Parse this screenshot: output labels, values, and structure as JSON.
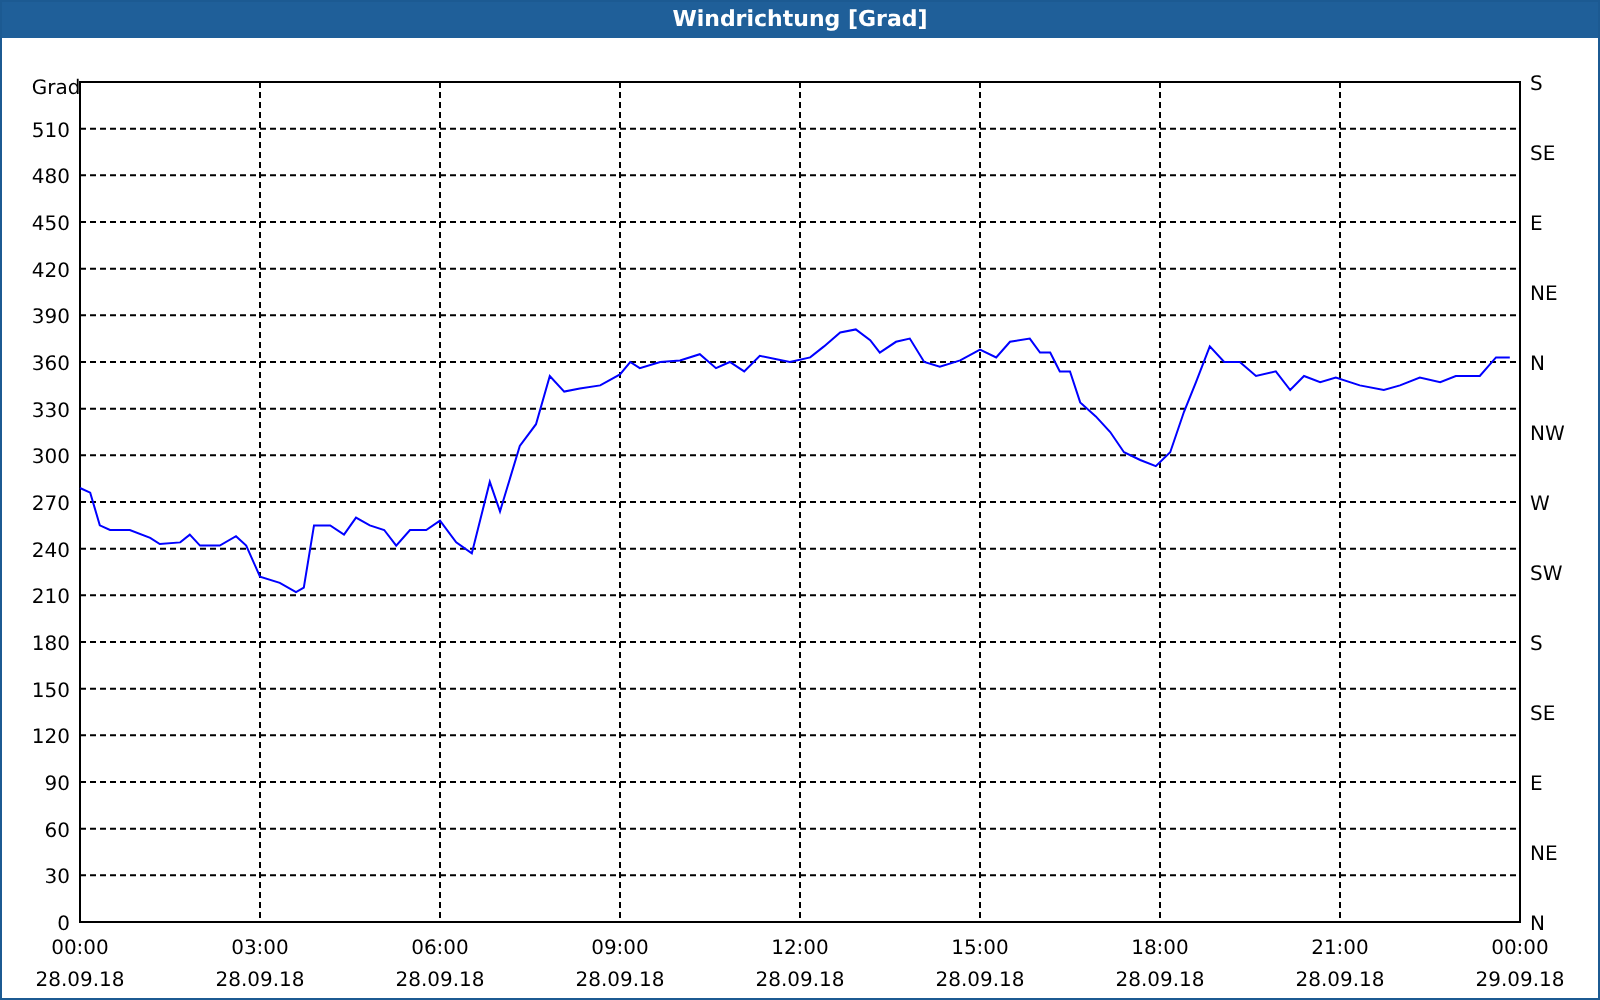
{
  "chart": {
    "chart_data": {
      "type": "line",
      "grid": true,
      "title": "Windrichtung [Grad]",
      "ylabel": "Grad",
      "ylim": [
        0,
        540
      ],
      "xlim": [
        0,
        24
      ],
      "yticks": [
        0,
        30,
        60,
        90,
        120,
        150,
        180,
        210,
        240,
        270,
        300,
        330,
        360,
        390,
        420,
        450,
        480,
        510
      ],
      "xticks": [
        {
          "value": 0,
          "label": "00:00"
        },
        {
          "value": 3,
          "label": "03:00"
        },
        {
          "value": 6,
          "label": "06:00"
        },
        {
          "value": 9,
          "label": "09:00"
        },
        {
          "value": 12,
          "label": "12:00"
        },
        {
          "value": 15,
          "label": "15:00"
        },
        {
          "value": 18,
          "label": "18:00"
        },
        {
          "value": 21,
          "label": "21:00"
        },
        {
          "value": 24,
          "label": "00:00"
        }
      ],
      "x": [
        0,
        0.17,
        0.33,
        0.5,
        0.83,
        1.17,
        1.33,
        1.67,
        1.83,
        2,
        2.33,
        2.6,
        2.77,
        3,
        3.33,
        3.6,
        3.73,
        3.9,
        4.17,
        4.4,
        4.6,
        4.83,
        5.07,
        5.27,
        5.5,
        5.77,
        6,
        6.27,
        6.53,
        6.83,
        7,
        7.33,
        7.6,
        7.83,
        8.07,
        8.33,
        8.67,
        9,
        9.17,
        9.33,
        9.67,
        10,
        10.33,
        10.6,
        10.83,
        11.07,
        11.33,
        11.83,
        12.17,
        12.4,
        12.67,
        12.93,
        13.17,
        13.33,
        13.6,
        13.83,
        14.07,
        14.33,
        14.67,
        15,
        15.27,
        15.5,
        15.83,
        16,
        16.17,
        16.33,
        16.5,
        16.67,
        16.93,
        17.17,
        17.4,
        17.67,
        17.93,
        18.17,
        18.4,
        18.6,
        18.83,
        19.07,
        19.33,
        19.6,
        19.93,
        20.17,
        20.4,
        20.67,
        20.93,
        21.33,
        21.73,
        22,
        22.33,
        22.67,
        22.93,
        23.33,
        23.6,
        23.83
      ],
      "series": [
        {
          "color": "#0000ff",
          "values": [
            279,
            276,
            255,
            252,
            252,
            247,
            243,
            244,
            249,
            242,
            242,
            248,
            242,
            222,
            218,
            212,
            215,
            255,
            255,
            249,
            260,
            255,
            252,
            242,
            252,
            252,
            258,
            244,
            237,
            283,
            264,
            306,
            320,
            351,
            341,
            343,
            345,
            352,
            360,
            356,
            360,
            361,
            365,
            356,
            360,
            354,
            364,
            360,
            363,
            370,
            379,
            381,
            374,
            366,
            373,
            375,
            360,
            357,
            361,
            368,
            363,
            373,
            375,
            366,
            366,
            354,
            354,
            334,
            325,
            315,
            302,
            297,
            293,
            302,
            328,
            347,
            370,
            360,
            360,
            351,
            354,
            342,
            351,
            347,
            350,
            345,
            342,
            345,
            350,
            347,
            351,
            351,
            363,
            363
          ]
        }
      ]
    },
    "x_date_labels": [
      "28.09.18",
      "28.09.18",
      "28.09.18",
      "28.09.18",
      "28.09.18",
      "28.09.18",
      "28.09.18",
      "28.09.18",
      "29.09.18"
    ],
    "compass_labels": [
      "S",
      "SE",
      "E",
      "NE",
      "N",
      "NW",
      "W",
      "SW",
      "S",
      "SE",
      "E",
      "NE",
      "N"
    ]
  }
}
